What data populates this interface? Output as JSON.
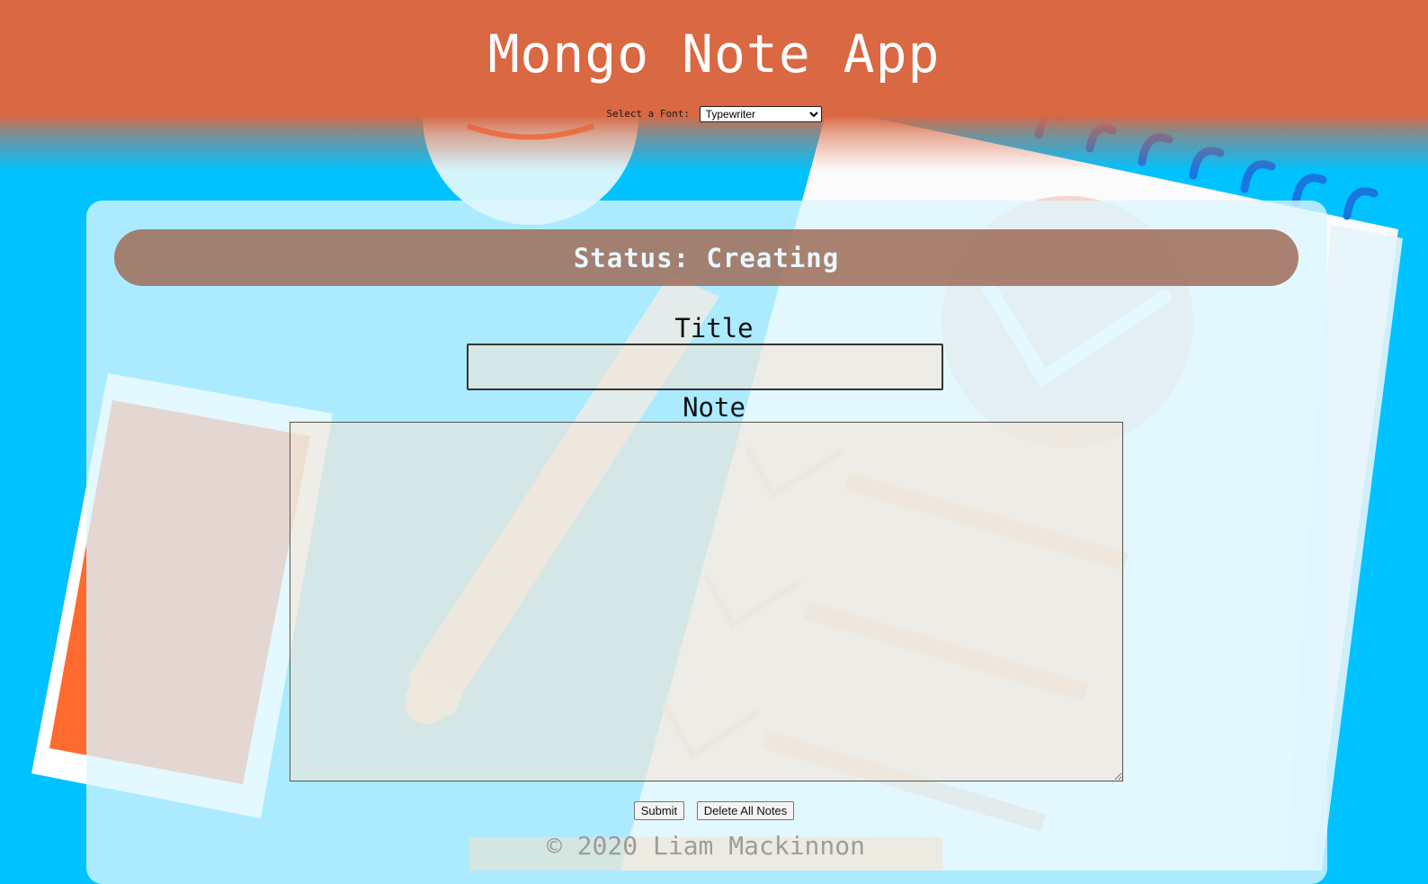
{
  "app": {
    "title": "Mongo Note App"
  },
  "font_selector": {
    "label": "Select a Font:",
    "selected": "Typewriter",
    "options": [
      "Typewriter"
    ]
  },
  "status": {
    "text": "Status: Creating"
  },
  "form": {
    "title_label": "Title",
    "title_value": "",
    "note_label": "Note",
    "note_value": ""
  },
  "buttons": {
    "submit": "Submit",
    "delete_all": "Delete All Notes"
  },
  "footer": {
    "text": "© 2020 Liam Mackinnon"
  },
  "colors": {
    "header": "#d96843",
    "background": "#00c2ff",
    "status_bar": "#a06e5a",
    "accent": "#ff7a45"
  }
}
